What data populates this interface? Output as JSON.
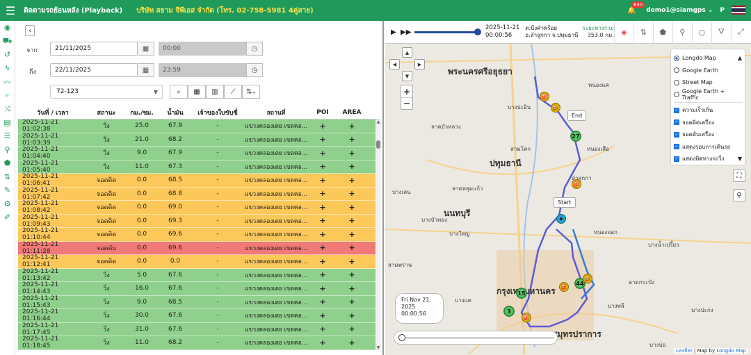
{
  "topbar": {
    "app_title": "ติดตามรถย้อนหลัง (Playback)",
    "company": "บริษัท สยาม จีพีเอส จำกัด (โทร. 02-758-5981 4คู่สาย)",
    "notifications": "830",
    "user": "demo1@siamgps",
    "user_initial": "P",
    "accent_color": "#1f9a5b"
  },
  "sidebar": {
    "icons": [
      "dashboard-icon",
      "truck-icon",
      "history-icon",
      "bolt-icon",
      "chart-line-icon",
      "search-icon",
      "shuffle-icon",
      "book-icon",
      "list-icon",
      "map-pin-icon",
      "polygon-icon",
      "swap-icon",
      "wrench-icon",
      "gear-icon",
      "edit-icon"
    ]
  },
  "form": {
    "from_label": "จาก",
    "to_label": "ถึง",
    "from_date": "21/11/2025",
    "to_date": "22/11/2025",
    "from_time": "00:00",
    "to_time": "23:59",
    "vehicle": "72-123"
  },
  "table": {
    "headers": [
      "วันที่ / เวลา",
      "สถานะ",
      "กม./ชม.",
      "น้ำมัน",
      "เจ้าของใบขับขี่",
      "สถานที่",
      "POI",
      "AREA"
    ],
    "rows": [
      {
        "time": "2025-11-21 01:02:38",
        "status": "วิ่ง",
        "speed": "25.0",
        "fuel": "67.9",
        "driver": "-",
        "place": "แขวงคลองเตย เขตคล...",
        "poi": "+",
        "area": "+",
        "color": "green"
      },
      {
        "time": "2025-11-21 01:03:39",
        "status": "วิ่ง",
        "speed": "21.0",
        "fuel": "68.2",
        "driver": "-",
        "place": "แขวงคลองเตย เขตคล...",
        "poi": "+",
        "area": "+",
        "color": "green"
      },
      {
        "time": "2025-11-21 01:04:40",
        "status": "วิ่ง",
        "speed": "9.0",
        "fuel": "67.9",
        "driver": "-",
        "place": "แขวงคลองเตย เขตคล...",
        "poi": "+",
        "area": "+",
        "color": "green"
      },
      {
        "time": "2025-11-21 01:05:40",
        "status": "วิ่ง",
        "speed": "11.0",
        "fuel": "67.3",
        "driver": "-",
        "place": "แขวงคลองเตย เขตคล...",
        "poi": "+",
        "area": "+",
        "color": "green"
      },
      {
        "time": "2025-11-21 01:06:41",
        "status": "จอดติด",
        "speed": "0.0",
        "fuel": "68.5",
        "driver": "-",
        "place": "แขวงคลองเตย เขตคล...",
        "poi": "+",
        "area": "+",
        "color": "orange"
      },
      {
        "time": "2025-11-21 01:07:42",
        "status": "จอดติด",
        "speed": "0.0",
        "fuel": "68.8",
        "driver": "-",
        "place": "แขวงคลองเตย เขตคล...",
        "poi": "+",
        "area": "+",
        "color": "orange"
      },
      {
        "time": "2025-11-21 01:08:42",
        "status": "จอดติด",
        "speed": "0.0",
        "fuel": "69.0",
        "driver": "-",
        "place": "แขวงคลองเตย เขตคล...",
        "poi": "+",
        "area": "+",
        "color": "orange"
      },
      {
        "time": "2025-11-21 01:09:43",
        "status": "จอดติด",
        "speed": "0.0",
        "fuel": "69.3",
        "driver": "-",
        "place": "แขวงคลองเตย เขตคล...",
        "poi": "+",
        "area": "+",
        "color": "orange"
      },
      {
        "time": "2025-11-21 01:10:44",
        "status": "จอดติด",
        "speed": "0.0",
        "fuel": "69.6",
        "driver": "-",
        "place": "แขวงคลองเตย เขตคล...",
        "poi": "+",
        "area": "+",
        "color": "orange"
      },
      {
        "time": "2025-11-21 01:11:28",
        "status": "จอดดับ",
        "speed": "0.0",
        "fuel": "69.6",
        "driver": "-",
        "place": "แขวงคลองเตย เขตคล...",
        "poi": "+",
        "area": "+",
        "color": "red"
      },
      {
        "time": "2025-11-21 01:12:41",
        "status": "จอดติด",
        "speed": "0.0",
        "fuel": "0.0",
        "driver": "-",
        "place": "แขวงคลองเตย เขตคล...",
        "poi": "+",
        "area": "+",
        "color": "orange"
      },
      {
        "time": "2025-11-21 01:13:42",
        "status": "วิ่ง",
        "speed": "5.0",
        "fuel": "67.6",
        "driver": "-",
        "place": "แขวงคลองเตย เขตคล...",
        "poi": "+",
        "area": "+",
        "color": "green"
      },
      {
        "time": "2025-11-21 01:14:43",
        "status": "วิ่ง",
        "speed": "16.0",
        "fuel": "67.6",
        "driver": "-",
        "place": "แขวงคลองเตย เขตคล...",
        "poi": "+",
        "area": "+",
        "color": "green"
      },
      {
        "time": "2025-11-21 01:15:43",
        "status": "วิ่ง",
        "speed": "9.0",
        "fuel": "68.5",
        "driver": "-",
        "place": "แขวงคลองเตย เขตคล...",
        "poi": "+",
        "area": "+",
        "color": "green"
      },
      {
        "time": "2025-11-21 01:16:44",
        "status": "วิ่ง",
        "speed": "30.0",
        "fuel": "67.6",
        "driver": "-",
        "place": "แขวงคลองเตย เขตคล...",
        "poi": "+",
        "area": "+",
        "color": "green"
      },
      {
        "time": "2025-11-21 01:17:45",
        "status": "วิ่ง",
        "speed": "31.0",
        "fuel": "67.6",
        "driver": "-",
        "place": "แขวงคลองเตย เขตคล...",
        "poi": "+",
        "area": "+",
        "color": "green"
      },
      {
        "time": "2025-11-21 01:18:45",
        "status": "วิ่ง",
        "speed": "11.0",
        "fuel": "68.2",
        "driver": "-",
        "place": "แขวงคลองเตย เขตคล...",
        "poi": "+",
        "area": "+",
        "color": "green"
      }
    ]
  },
  "playback": {
    "date": "2025-11-21",
    "time": "00:00:56",
    "addr1": "ต.บึงคำพร้อย",
    "addr2": "อ.ลำลูกกา จ.ปทุมธานี",
    "dist_label": "ระยะทางรวม",
    "dist_value": "353.0 กม."
  },
  "layers": {
    "base": [
      "Longdo Map",
      "Google Earth",
      "Street Map",
      "Google Earth + Traffic"
    ],
    "selected": "Longdo Map",
    "overlays": [
      "ความเร็วเกิน",
      "จอดติดเครื่อง",
      "จอดดับเครื่อง",
      "แสดงรอบการเดินรถ",
      "แสดงทิศทางรถวิ่ง"
    ]
  },
  "map": {
    "labels": [
      "พระนครศรีอยุธยา",
      "ปทุมธานี",
      "นนทบุรี",
      "กรุงเทพมหานคร",
      "สมุทรปราการ",
      "บางปะอิน",
      "หนองแค",
      "หนองเสือ",
      "ลาดบัวหลวง",
      "บางเลน",
      "บางใหญ่",
      "สามโคก",
      "ลาดหลุมแก้ว",
      "บางบัวทอง",
      "ลำลูกกา",
      "หนองจอก",
      "บางน้ำเปรี้ยว",
      "บางปะกง",
      "บางพลี",
      "ลาดกระบัง",
      "สามพราน",
      "บางแค",
      "บางบ่อ"
    ],
    "tip_end": "End",
    "tip_start": "Start",
    "cluster_27": "27",
    "cluster_44": "44",
    "cluster_3": "3",
    "cluster_15": "15",
    "info_line1": "Fri Nov 21,",
    "info_line2": "2025",
    "info_line3": "00:00:56",
    "attrib_a": "Leaflet",
    "attrib_sep": " | Map by ",
    "attrib_b": "Longdo Map",
    "route_color": "#5b5bd6"
  }
}
